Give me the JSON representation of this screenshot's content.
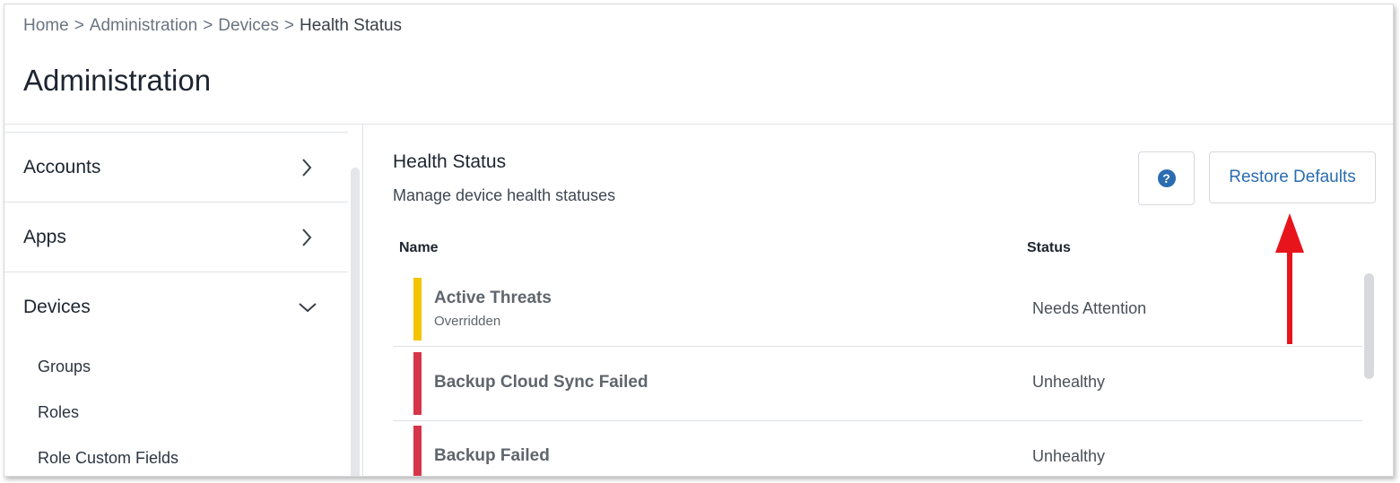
{
  "breadcrumb": {
    "items": [
      "Home",
      "Administration",
      "Devices"
    ],
    "current": "Health Status",
    "separator": ">"
  },
  "page": {
    "title": "Administration"
  },
  "sidebar": {
    "items": [
      {
        "label": "Accounts",
        "expanded": false
      },
      {
        "label": "Apps",
        "expanded": false
      },
      {
        "label": "Devices",
        "expanded": true
      }
    ],
    "subitems": [
      "Groups",
      "Roles",
      "Role Custom Fields"
    ]
  },
  "main": {
    "title": "Health Status",
    "subtitle": "Manage device health statuses",
    "help_icon": "question-mark-icon",
    "help_label": "?",
    "restore_label": "Restore Defaults",
    "columns": {
      "name": "Name",
      "status": "Status"
    },
    "rows": [
      {
        "name": "Active Threats",
        "sub": "Overridden",
        "status": "Needs Attention",
        "color": "#f5c400"
      },
      {
        "name": "Backup Cloud Sync Failed",
        "sub": "",
        "status": "Unhealthy",
        "color": "#d63649"
      },
      {
        "name": "Backup Failed",
        "sub": "",
        "status": "Unhealthy",
        "color": "#d63649"
      }
    ]
  },
  "colors": {
    "accent": "#2b6cb0",
    "annotation_arrow": "#e8141b"
  }
}
